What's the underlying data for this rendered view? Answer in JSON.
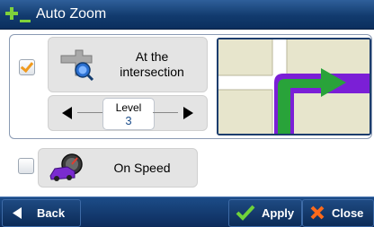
{
  "window": {
    "title": "Auto Zoom"
  },
  "options": [
    {
      "label": "At the intersection",
      "label_line1": "At the",
      "label_line2": "intersection",
      "checked": true
    },
    {
      "label": "On Speed",
      "checked": false
    }
  ],
  "level": {
    "label": "Level",
    "value": "3"
  },
  "footer": {
    "back_label": "Back",
    "apply_label": "Apply",
    "close_label": "Close"
  },
  "icons": {
    "title": "add-zoom-icon",
    "option1": "intersection-zoom-icon",
    "option2": "car-speed-icon",
    "level_prev": "left-arrow-icon",
    "level_next": "right-arrow-icon",
    "back": "left-arrow-icon",
    "apply": "checkmark-icon",
    "close": "x-icon",
    "preview": "intersection-map-preview"
  },
  "colors": {
    "titlebar": "#123b6e",
    "check_orange": "#f09a1e",
    "route_green": "#29a33a",
    "route_purple": "#7b1fd6",
    "level_value": "#1e4f8c"
  }
}
